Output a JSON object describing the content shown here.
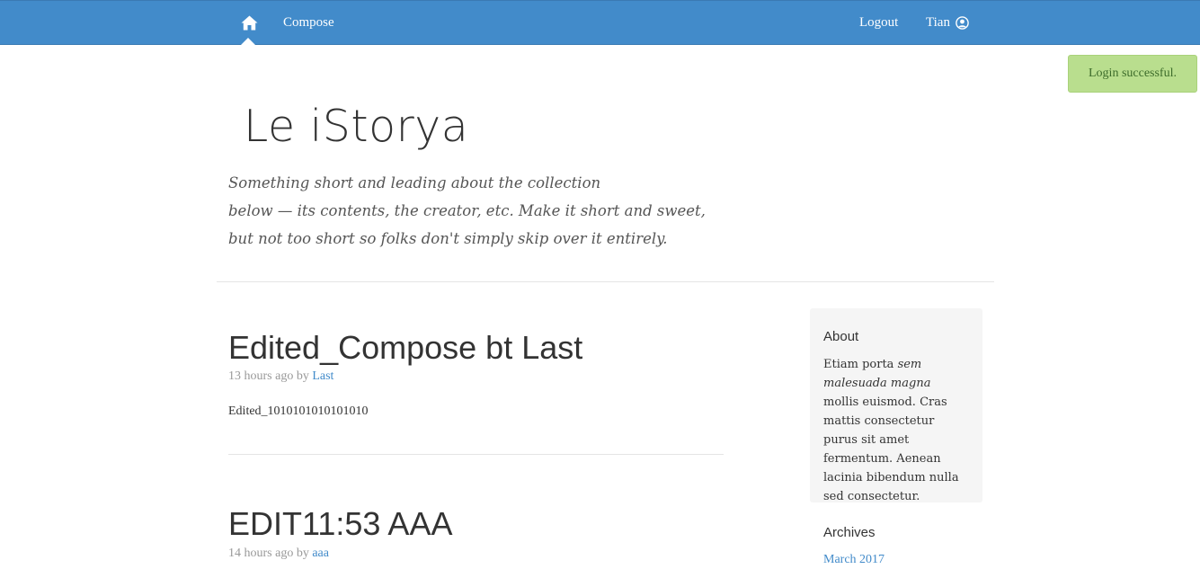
{
  "navbar": {
    "home_icon": "home-icon",
    "compose_label": "Compose",
    "logout_label": "Logout",
    "user_name": "Tian",
    "user_icon": "user-circle-icon",
    "background_color": "#428bca"
  },
  "toast": {
    "message": "Login successful.",
    "background_color": "#b9de8e"
  },
  "header": {
    "title": "Le iStorya",
    "description_lines": [
      "Something short and leading about the collection",
      "below — its contents, the creator, etc. Make it short and sweet,",
      "but not too short so folks don't simply skip over it entirely."
    ]
  },
  "posts": [
    {
      "title": "Edited_Compose bt Last",
      "meta_prefix": "13 hours ago by",
      "author": "Last",
      "body": "Edited_1010101010101010"
    },
    {
      "title": "EDIT11:53 AAA",
      "meta_prefix": "14 hours ago by",
      "author": "aaa"
    }
  ],
  "sidebar": {
    "about": {
      "heading": "About",
      "text_part1": "Etiam porta ",
      "text_em": "sem malesuada magna",
      "text_part2": " mollis euismod. Cras mattis consectetur purus sit amet fermentum. Aenean lacinia bibendum nulla sed consectetur."
    },
    "archives": {
      "heading": "Archives",
      "items": [
        "March 2017"
      ]
    }
  },
  "colors": {
    "link": "#428bca",
    "muted": "#999999",
    "text": "#333333"
  }
}
